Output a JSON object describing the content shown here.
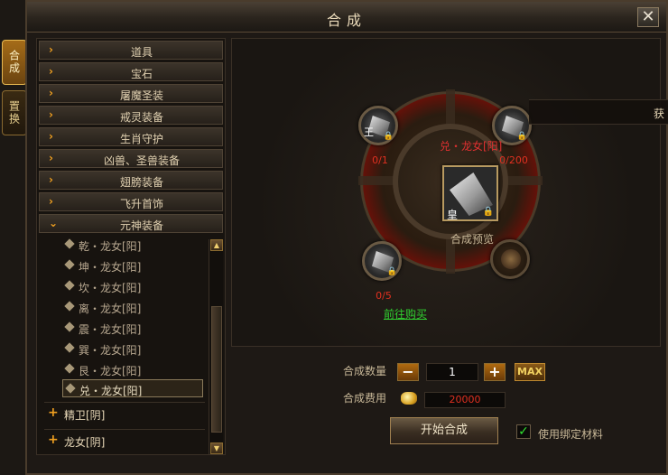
{
  "window": {
    "title": "合成",
    "close_label": "✕"
  },
  "side_tabs": [
    {
      "label": "合成"
    },
    {
      "label": "置换"
    }
  ],
  "categories": [
    {
      "label": "道具"
    },
    {
      "label": "宝石"
    },
    {
      "label": "屠魔圣装"
    },
    {
      "label": "戒灵装备"
    },
    {
      "label": "生肖守护"
    },
    {
      "label": "凶兽、圣兽装备"
    },
    {
      "label": "翅膀装备"
    },
    {
      "label": "飞升首饰"
    },
    {
      "label": "元神装备"
    }
  ],
  "sub_items": [
    {
      "label": "乾・龙女[阳]"
    },
    {
      "label": "坤・龙女[阳]"
    },
    {
      "label": "坎・龙女[阳]"
    },
    {
      "label": "离・龙女[阳]"
    },
    {
      "label": "震・龙女[阳]"
    },
    {
      "label": "巽・龙女[阳]"
    },
    {
      "label": "艮・龙女[阳]"
    },
    {
      "label": "兑・龙女[阳]"
    }
  ],
  "groups": [
    {
      "label": "精卫[阴]"
    },
    {
      "label": "龙女[阴]"
    }
  ],
  "preview": {
    "target_name": "兑・龙女[阳]",
    "slot_tl_glyph": "王",
    "slot_tl_qty": "0/1",
    "slot_tr_qty": "0/200",
    "slot_bl_qty": "0/5",
    "center_glyph": "皇",
    "center_label": "合成预览",
    "buy_link": "前往购买"
  },
  "form": {
    "quantity_label": "合成数量",
    "minus_label": "−",
    "quantity_value": "1",
    "plus_label": "+",
    "max_label": "MAX",
    "fee_label": "合成费用",
    "fee_value": "20000",
    "start_label": "开始合成",
    "bind_label": "使用绑定材料",
    "bind_checked": "✓"
  },
  "overlay": {
    "right_text": "获"
  },
  "icons": {
    "arrow": "chevron-right-icon",
    "expanded": "chevron-down-icon",
    "lock": "lock-icon",
    "gold": "gold-ingot-icon"
  }
}
